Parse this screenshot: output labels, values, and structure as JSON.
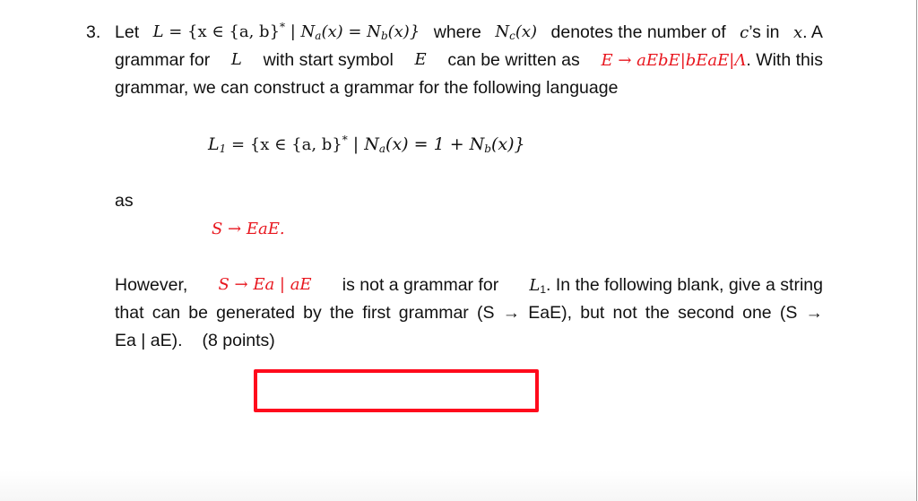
{
  "question": {
    "number": "3.",
    "line1": {
      "w1": "Let",
      "set_def": "L = {x ∈ {a, b}* | Nₐ(x) = N_b(x)}",
      "lhs": "L",
      "eq": " = {x ∈ {a, b}",
      "star": "*",
      "bar": " | N",
      "sub_a": "a",
      "mid": "(x) = N",
      "sub_b": "b",
      "end": "(x)}",
      "w2": "where",
      "nc": "N",
      "sub_c": "c",
      "nc_arg": "(x)",
      "w3": "denotes the number of",
      "c": "c",
      "w4": "’s in",
      "x": "x",
      "w5": ". A"
    },
    "line2": {
      "w1": "grammar for",
      "L": "L",
      "w2": "with start symbol",
      "E": "E",
      "w3": "can be written as",
      "production": "E → aEbE|bEaE|Λ",
      "w4": ". With this"
    },
    "line3": "grammar, we can construct a grammar for the following language",
    "language": {
      "name": "L",
      "sub": "1",
      "eq": " = {x ∈ {a, b}",
      "star": "*",
      "bar": " | N",
      "sub_a": "a",
      "mid": "(x) = 1 + N",
      "sub_b": "b",
      "end": "(x)}"
    },
    "as_label": "as",
    "grammar1": "S → EaE.",
    "para2": {
      "w1": "However,",
      "grammar2": "S → Ea | aE",
      "w2": "is not a grammar for",
      "L": "L",
      "L_sub": "1",
      "w3": ". In the following blank, give a string",
      "line2": "that can be generated by the first grammar (S → EaE), but not the second one (S →",
      "line3a": "Ea | aE).",
      "line3b": "(8 points)"
    }
  },
  "answer": {
    "value": ""
  },
  "colors": {
    "highlight_red": "#e8161e",
    "box_red": "#ff0a1c",
    "text": "#111111"
  }
}
